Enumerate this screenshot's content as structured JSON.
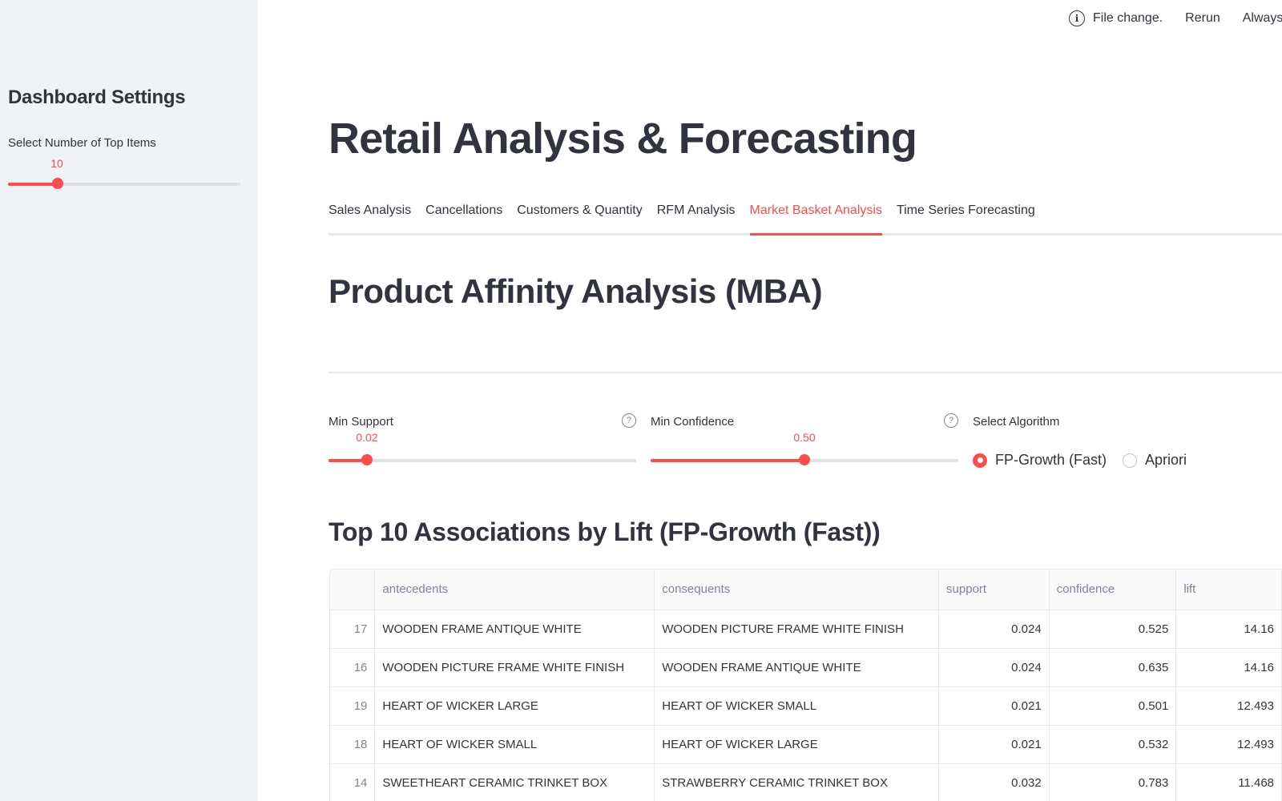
{
  "sidebar": {
    "title": "Dashboard Settings",
    "top_items": {
      "label": "Select Number of Top Items",
      "value": "10",
      "fraction": 0.214
    }
  },
  "topbar": {
    "status": "File change.",
    "rerun": "Rerun",
    "always": "Always rerun"
  },
  "main": {
    "title": "Retail Analysis & Forecasting",
    "tabs": [
      {
        "label": "Sales Analysis",
        "active": false
      },
      {
        "label": "Cancellations",
        "active": false
      },
      {
        "label": "Customers & Quantity",
        "active": false
      },
      {
        "label": "RFM Analysis",
        "active": false
      },
      {
        "label": "Market Basket Analysis",
        "active": true
      },
      {
        "label": "Time Series Forecasting",
        "active": false
      }
    ],
    "section_title": "Product Affinity Analysis (MBA)",
    "min_support": {
      "label": "Min Support",
      "value": "0.02",
      "fraction": 0.125
    },
    "min_confidence": {
      "label": "Min Confidence",
      "value": "0.50",
      "fraction": 0.5
    },
    "algorithm": {
      "label": "Select Algorithm",
      "options": [
        "FP-Growth (Fast)",
        "Apriori"
      ],
      "selected": "FP-Growth (Fast)"
    },
    "table_title": "Top 10 Associations by Lift (FP-Growth (Fast))",
    "table": {
      "columns": [
        "",
        "antecedents",
        "consequents",
        "support",
        "confidence",
        "lift"
      ],
      "rows": [
        [
          "17",
          "WOODEN FRAME ANTIQUE WHITE",
          "WOODEN PICTURE FRAME WHITE FINISH",
          "0.024",
          "0.525",
          "14.16"
        ],
        [
          "16",
          "WOODEN PICTURE FRAME WHITE FINISH",
          "WOODEN FRAME ANTIQUE WHITE",
          "0.024",
          "0.635",
          "14.16"
        ],
        [
          "19",
          "HEART OF WICKER LARGE",
          "HEART OF WICKER SMALL",
          "0.021",
          "0.501",
          "12.493"
        ],
        [
          "18",
          "HEART OF WICKER SMALL",
          "HEART OF WICKER LARGE",
          "0.021",
          "0.532",
          "12.493"
        ],
        [
          "14",
          "SWEETHEART CERAMIC TRINKET BOX",
          "STRAWBERRY CERAMIC TRINKET BOX",
          "0.032",
          "0.783",
          "11.468"
        ]
      ]
    }
  },
  "colors": {
    "accent": "#ff4b4b",
    "sidebar_bg": "#f0f2f6",
    "text": "#31333f",
    "muted": "#808495"
  },
  "icons": {
    "info": "info-icon",
    "help": "help-icon"
  }
}
